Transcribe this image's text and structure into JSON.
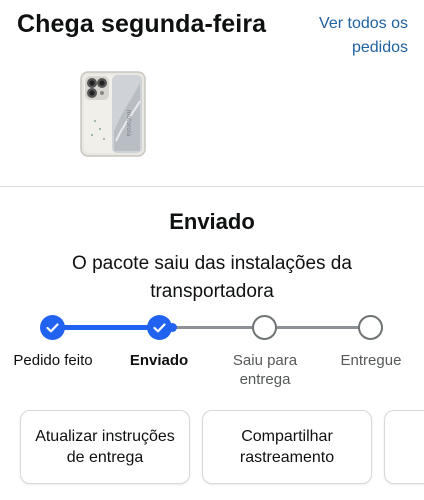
{
  "header": {
    "title": "Chega segunda-feira",
    "see_all_line1": "Ver todos os",
    "see_all_line2": "pedidos"
  },
  "product": {
    "image_alt": "Smartphone Motorola Edge"
  },
  "status": {
    "title": "Enviado",
    "description_line1": "O pacote saiu das instalações da",
    "description_line2": "transportadora"
  },
  "tracker": {
    "steps": [
      {
        "label_line1": "Pedido feito",
        "label_line2": "",
        "state": "done"
      },
      {
        "label_line1": "Enviado",
        "label_line2": "",
        "state": "current"
      },
      {
        "label_line1": "Saiu para",
        "label_line2": "entrega",
        "state": "pending"
      },
      {
        "label_line1": "Entregue",
        "label_line2": "",
        "state": "pending"
      }
    ]
  },
  "actions": [
    {
      "line1": "Atualizar instruções",
      "line2": "de entrega"
    },
    {
      "line1": "Compartilhar",
      "line2": "rastreamento"
    }
  ],
  "colors": {
    "accent": "#2162f1",
    "link": "#2162a1",
    "pending_ring": "#6f7373"
  }
}
